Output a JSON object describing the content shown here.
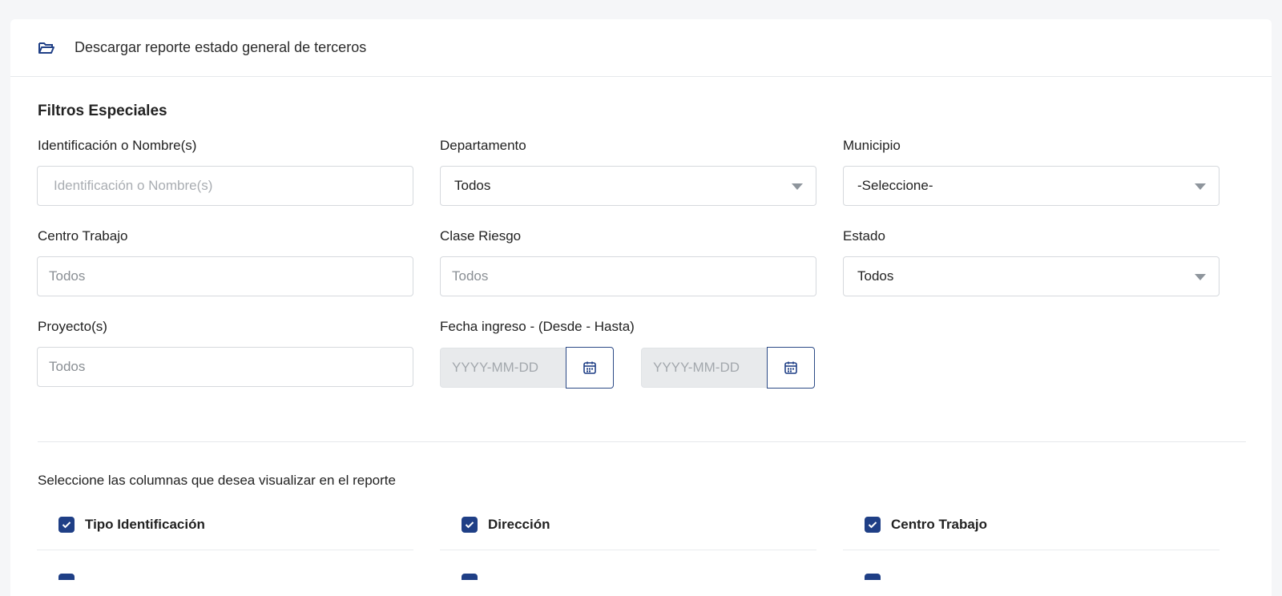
{
  "header": {
    "title": "Descargar reporte estado general de terceros",
    "icon": "folder-open-icon"
  },
  "filters": {
    "section_title": "Filtros Especiales",
    "identificacion": {
      "label": "Identificación o Nombre(s)",
      "placeholder": "Identificación o Nombre(s)"
    },
    "departamento": {
      "label": "Departamento",
      "value": "Todos"
    },
    "municipio": {
      "label": "Municipio",
      "value": "-Seleccione-"
    },
    "centro_trabajo": {
      "label": "Centro Trabajo",
      "value": "Todos"
    },
    "clase_riesgo": {
      "label": "Clase Riesgo",
      "value": "Todos"
    },
    "estado": {
      "label": "Estado",
      "value": "Todos"
    },
    "proyecto": {
      "label": "Proyecto(s)",
      "value": "Todos"
    },
    "fecha_ingreso": {
      "label": "Fecha ingreso - (Desde - Hasta)",
      "desde_placeholder": "YYYY-MM-DD",
      "hasta_placeholder": "YYYY-MM-DD"
    }
  },
  "columns": {
    "instruction": "Seleccione las columnas que desea visualizar en el reporte",
    "items": [
      {
        "label": "Tipo Identificación",
        "checked": true
      },
      {
        "label": "Dirección",
        "checked": true
      },
      {
        "label": "Centro Trabajo",
        "checked": true
      }
    ]
  },
  "colors": {
    "accent": "#1f3f86",
    "border": "#d6d9dd",
    "disabled_bg": "#e8eaec"
  }
}
